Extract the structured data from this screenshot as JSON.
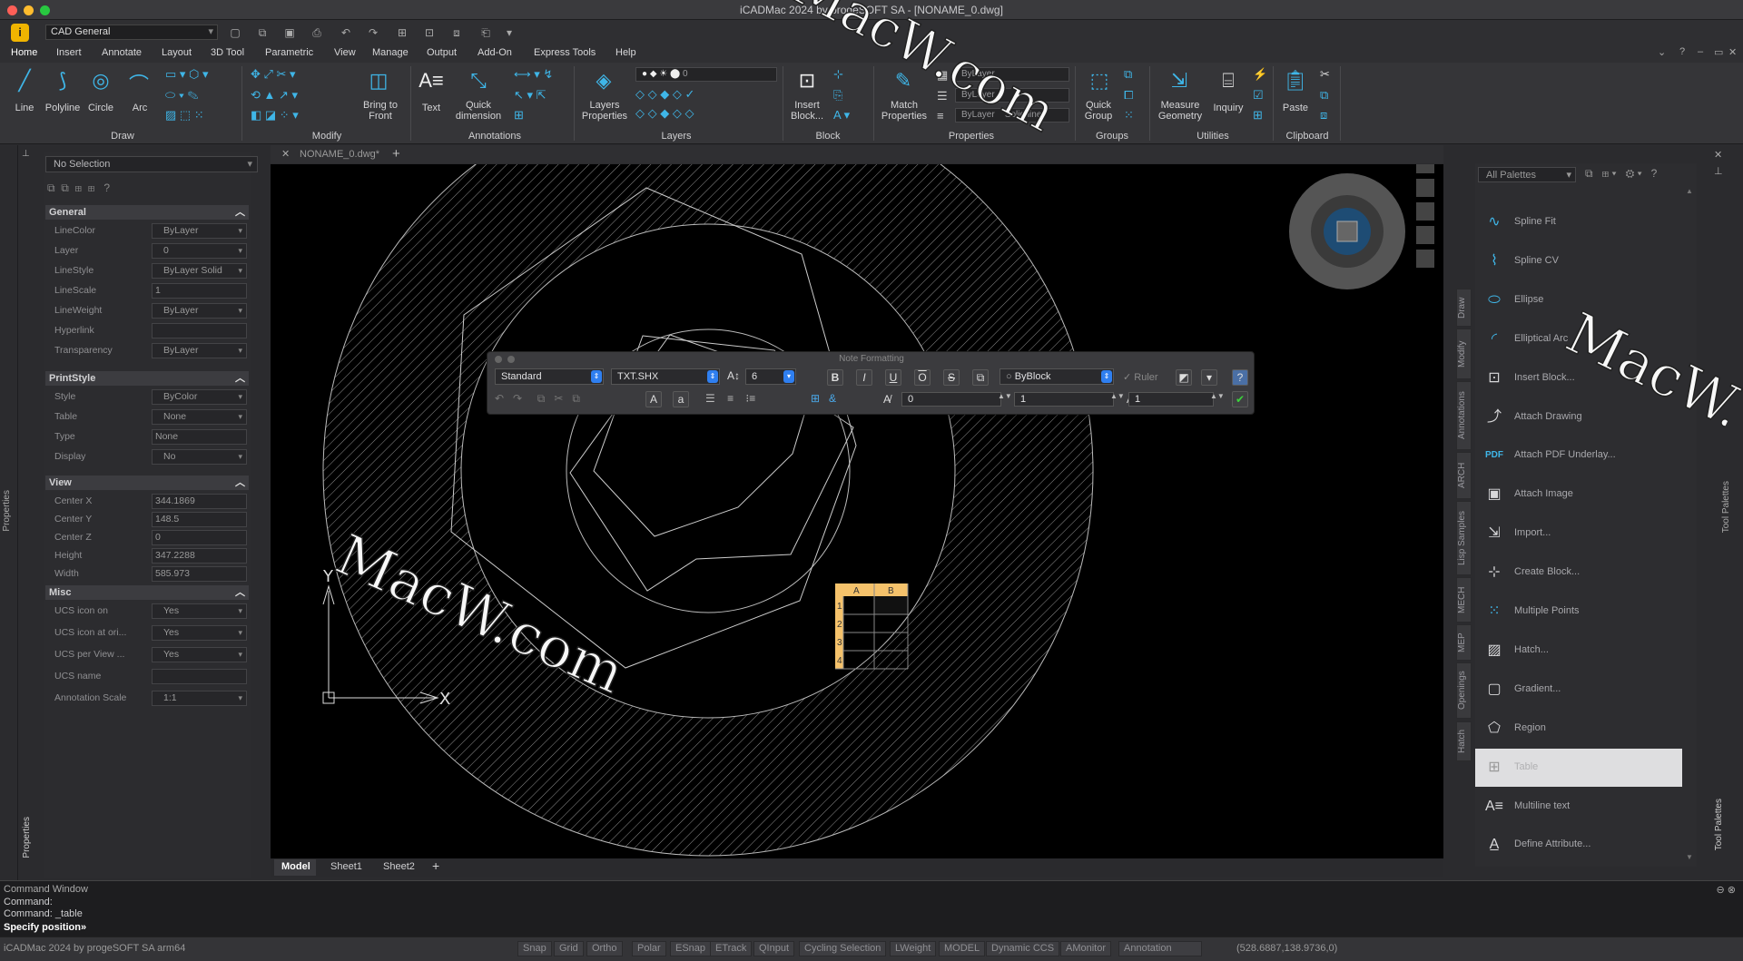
{
  "window": {
    "title": "iCADMac 2024 by progeSOFT SA - [NONAME_0.dwg]",
    "traffic_colors": [
      "#fe5f57",
      "#febc2e",
      "#28c840"
    ]
  },
  "quick_access": {
    "app_icon": "i",
    "workspace": "CAD General",
    "icons": [
      "new-icon",
      "open-icon",
      "save-icon",
      "print-icon",
      "undo-icon",
      "redo-icon",
      "match-icon",
      "publish-icon",
      "copy-icon",
      "plot-icon",
      "customize-icon"
    ]
  },
  "menu": {
    "tabs": [
      "Home",
      "Insert",
      "Annotate",
      "Layout",
      "3D Tool",
      "Parametric",
      "View",
      "Manage",
      "Output",
      "Add-On",
      "Express Tools",
      "Help"
    ],
    "active": "Home"
  },
  "ribbon": {
    "draw": {
      "group": "Draw",
      "buttons": [
        "Line",
        "Polyline",
        "Circle",
        "Arc"
      ]
    },
    "modify": {
      "group": "Modify",
      "bring_to_front": "Bring to\nFront"
    },
    "annotations": {
      "group": "Annotations",
      "text": "Text",
      "quick_dimension": "Quick\ndimension"
    },
    "layers": {
      "group": "Layers",
      "properties": "Layers\nProperties",
      "current_layer": "0"
    },
    "block": {
      "group": "Block",
      "insert": "Insert\nBlock..."
    },
    "properties": {
      "group": "Properties",
      "match": "Match\nProperties",
      "layer": "ByLayer",
      "color": "ByLayer",
      "linetype_a": "ByLayer",
      "linetype_b": "Solid line",
      "lineweight": "ByLayer"
    },
    "groups": {
      "group": "Groups",
      "quick_group": "Quick\nGroup"
    },
    "utilities": {
      "group": "Utilities",
      "measure": "Measure\nGeometry",
      "inquiry": "Inquiry"
    },
    "clipboard": {
      "group": "Clipboard",
      "paste": "Paste"
    }
  },
  "properties_panel": {
    "selection": "No Selection",
    "strip_label": "Properties",
    "sections": {
      "general": {
        "title": "General",
        "rows": [
          {
            "name": "LineColor",
            "value": "ByLayer"
          },
          {
            "name": "Layer",
            "value": "0"
          },
          {
            "name": "LineStyle",
            "value": "ByLayer    Solid"
          },
          {
            "name": "LineScale",
            "value": "1"
          },
          {
            "name": "LineWeight",
            "value": "ByLayer"
          },
          {
            "name": "Hyperlink",
            "value": ""
          },
          {
            "name": "Transparency",
            "value": "ByLayer"
          }
        ]
      },
      "printstyle": {
        "title": "PrintStyle",
        "rows": [
          {
            "name": "Style",
            "value": "ByColor"
          },
          {
            "name": "Table",
            "value": "None"
          },
          {
            "name": "Type",
            "value": "None"
          },
          {
            "name": "Display",
            "value": "No"
          }
        ]
      },
      "view": {
        "title": "View",
        "rows": [
          {
            "name": "Center X",
            "value": "344.1869"
          },
          {
            "name": "Center Y",
            "value": "148.5"
          },
          {
            "name": "Center Z",
            "value": "0"
          },
          {
            "name": "Height",
            "value": "347.2288"
          },
          {
            "name": "Width",
            "value": "585.973"
          }
        ]
      },
      "misc": {
        "title": "Misc",
        "rows": [
          {
            "name": "UCS icon on",
            "value": "Yes"
          },
          {
            "name": "UCS icon at ori...",
            "value": "Yes"
          },
          {
            "name": "UCS per View ...",
            "value": "Yes"
          },
          {
            "name": "UCS name",
            "value": ""
          },
          {
            "name": "Annotation Scale",
            "value": "1:1"
          }
        ]
      }
    }
  },
  "document": {
    "tab": "NONAME_0.dwg*",
    "sheets": [
      "Model",
      "Sheet1",
      "Sheet2"
    ],
    "active_sheet": "Model",
    "axis_y": "Y",
    "axis_x": "X",
    "table_cols": [
      "A",
      "B"
    ],
    "table_rows": [
      "1",
      "2",
      "3",
      "4"
    ]
  },
  "note_formatting": {
    "title": "Note Formatting",
    "style": "Standard",
    "font": "TXT.SHX",
    "height": "6",
    "color": "ByBlock",
    "ruler": "Ruler",
    "oblique": "0",
    "tracking": "1",
    "width_factor": "1",
    "format_buttons": [
      "B",
      "I",
      "U",
      "O",
      "S"
    ]
  },
  "palette": {
    "filter": "All Palettes",
    "vertical_tabs": [
      "Draw",
      "Modify",
      "Annotations",
      "ARCH",
      "Lisp Samples",
      "MECH",
      "MEP",
      "Openings",
      "Hatch"
    ],
    "right_label": "Tool Palettes",
    "items": [
      {
        "label": "Spline Fit",
        "icon": "spline-fit-icon"
      },
      {
        "label": "Spline CV",
        "icon": "spline-cv-icon"
      },
      {
        "label": "Ellipse",
        "icon": "ellipse-icon"
      },
      {
        "label": "Elliptical Arc",
        "icon": "elliptical-arc-icon"
      },
      {
        "label": "Insert Block...",
        "icon": "insert-block-icon"
      },
      {
        "label": "Attach Drawing",
        "icon": "attach-drawing-icon"
      },
      {
        "label": "Attach PDF Underlay...",
        "icon": "pdf-icon"
      },
      {
        "label": "Attach Image",
        "icon": "attach-image-icon"
      },
      {
        "label": "Import...",
        "icon": "import-icon"
      },
      {
        "label": "Create Block...",
        "icon": "create-block-icon"
      },
      {
        "label": "Multiple Points",
        "icon": "points-icon"
      },
      {
        "label": "Hatch...",
        "icon": "hatch-icon"
      },
      {
        "label": "Gradient...",
        "icon": "gradient-icon"
      },
      {
        "label": "Region",
        "icon": "region-icon"
      },
      {
        "label": "Table",
        "icon": "table-icon"
      },
      {
        "label": "Multiline text",
        "icon": "mtext-icon"
      },
      {
        "label": "Define Attribute...",
        "icon": "attribute-icon"
      }
    ],
    "selected": "Table"
  },
  "command_window": {
    "title": "Command Window",
    "lines": [
      "Command:",
      "Command: _table"
    ],
    "prompt": "Specify position»"
  },
  "status_bar": {
    "app": "iCADMac 2024 by progeSOFT SA arm64",
    "toggles": [
      "Snap",
      "Grid",
      "Ortho",
      "Polar",
      "ESnap",
      "ETrack",
      "QInput",
      "Cycling Selection",
      "LWeight",
      "MODEL",
      "Dynamic CCS",
      "AMonitor",
      "Annotation"
    ],
    "coords": "(528.6887,138.9736,0)"
  },
  "watermark": "MacW.com"
}
